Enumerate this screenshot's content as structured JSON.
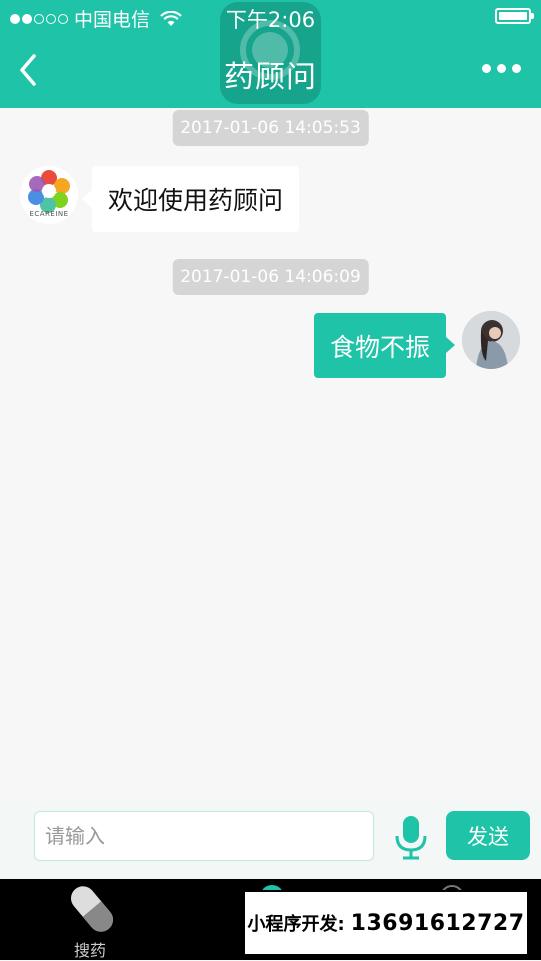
{
  "status_bar": {
    "carrier": "中国电信",
    "time": "下午2:06",
    "signal_icon": "signal-dots-icon",
    "wifi_icon": "wifi-icon",
    "battery_icon": "battery-icon"
  },
  "header": {
    "title": "药顾问",
    "back_icon": "chevron-left-icon",
    "more_icon": "more-dots-icon",
    "background": "#1ec3a8"
  },
  "chat": {
    "messages": [
      {
        "timestamp": "2017-01-06 14:05:53",
        "sender": "bot",
        "text": "欢迎使用药顾问",
        "avatar_caption": "ECAREINE"
      },
      {
        "timestamp": "2017-01-06 14:06:09",
        "sender": "user",
        "text": "食物不振"
      }
    ]
  },
  "input_bar": {
    "placeholder": "请输入",
    "mic_icon": "microphone-icon",
    "send_label": "发送"
  },
  "tab_bar": {
    "tabs": [
      {
        "label": "搜药",
        "icon": "pill-icon"
      },
      {
        "label": "",
        "icon": "tab-icon-2"
      },
      {
        "label": "",
        "icon": "tab-icon-3"
      }
    ]
  },
  "promo": {
    "label": "小程序开发:",
    "phone": "13691612727"
  },
  "colors": {
    "accent": "#1ec3a8",
    "timestamp_bg": "#d5d5d5",
    "background": "#f7f7f7"
  }
}
